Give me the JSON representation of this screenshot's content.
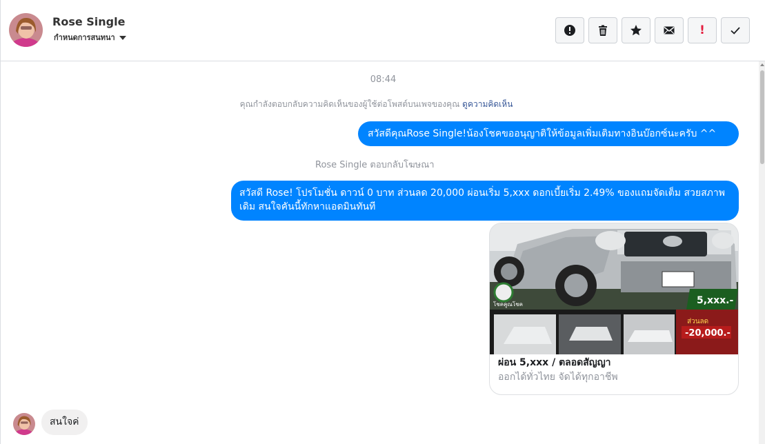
{
  "header": {
    "contact_name": "Rose Single",
    "label_dropdown": "กำหนดการสนทนา",
    "actions": [
      {
        "icon": "exclamation-circle-icon"
      },
      {
        "icon": "trash-icon"
      },
      {
        "icon": "star-icon"
      },
      {
        "icon": "envelope-icon"
      },
      {
        "icon": "red-exclamation-icon",
        "text": "!",
        "color": "#e41e3f"
      },
      {
        "icon": "check-icon"
      }
    ]
  },
  "conversation": {
    "timestamp": "08:44",
    "context_text": "คุณกำลังตอบกลับความคิดเห็นของผู้ใช้ต่อโพสต์บนเพจของคุณ",
    "context_link": "ดูความคิดเห็น",
    "messages": [
      {
        "direction": "outgoing",
        "text": "สวัสดีคุณRose Single!น้องโชคขออนุญาติให้ข้อมูลเพิ่มเติมทางอินบ๊อกซ์นะครับ ^^"
      },
      {
        "direction": "outgoing",
        "text": "สวัสดี Rose! โปรโมชั่น ดาวน์ 0 บาท ส่วนลด 20,000 ผ่อนเริ่ม 5,xxx ดอกเบี้ยเริ่ม 2.49% ของแถมจัดเต็ม สวยสภาพเดิม สนใจคันนี้ทักหาแอดมินทันที"
      },
      {
        "direction": "incoming",
        "text": "สนใจค่"
      }
    ],
    "reply_note": "Rose Single ตอบกลับโฆษณา",
    "ad_card": {
      "title": "ผ่อน 5,xxx / ตลอดสัญญา",
      "subtitle": "ออกได้ทั่วไทย จัดได้ทุกอาชีพ",
      "image_texts": {
        "installment": "5,xxx.-",
        "discount_label": "ส่วนลด",
        "discount": "-20,000.-"
      }
    }
  },
  "colors": {
    "outgoing_bubble": "#0084ff",
    "incoming_bubble": "#f1f0f0",
    "link": "#385898",
    "muted_text": "#90949c"
  }
}
